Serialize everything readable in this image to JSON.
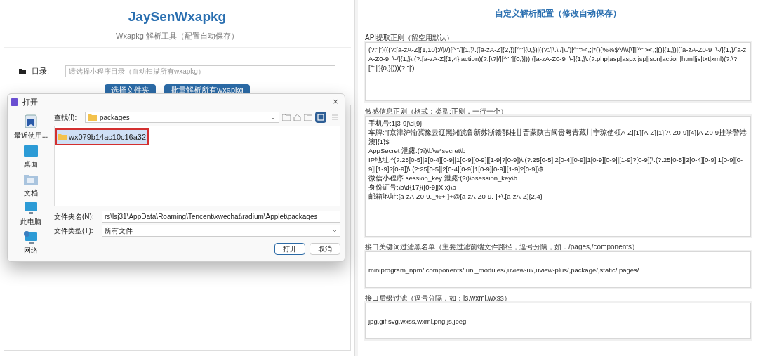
{
  "app": {
    "title": "JaySenWxapkg",
    "subtitle": "Wxapkg 解析工具（配置自动保存）"
  },
  "directory": {
    "label": "目录:",
    "placeholder": "请选择小程序目录（自动扫描所有wxapkg）"
  },
  "actions": [
    "选择文件夹",
    "批量解析所有wxapkg"
  ],
  "dialog": {
    "title": "打开",
    "close": "×",
    "places": [
      {
        "kind": "recent",
        "label": "最近使用..."
      },
      {
        "kind": "desktop",
        "label": "桌面"
      },
      {
        "kind": "documents",
        "label": "文档"
      },
      {
        "kind": "computer",
        "label": "此电脑"
      },
      {
        "kind": "network",
        "label": "网络"
      }
    ],
    "look_in": {
      "label": "查找(I):",
      "value": "packages"
    },
    "view_buttons": [
      {
        "kind": "detail",
        "selected": true
      },
      {
        "kind": "list",
        "selected": false
      }
    ],
    "files": [
      {
        "name": "wx079b14ac10c16a32",
        "selected": true
      }
    ],
    "filename": {
      "label": "文件夹名(N):",
      "value": "rs\\lsj31\\AppData\\Roaming\\Tencent\\xwechat\\radium\\Applet\\packages"
    },
    "filetype": {
      "label": "文件类型(T):",
      "value": "所有文件"
    },
    "buttons": [
      "打开",
      "取消"
    ]
  },
  "config": {
    "title": "自定义解析配置（修改自动保存）",
    "groups": [
      {
        "label": "API提取正则（留空用默认）",
        "lines": [
          "(?:\"|')(((?:[a-zA-Z]{1,10}://|//)[^\"'/]{1,}\\.([a-zA-Z]{2,})[^\"']{0,})|((?:/|\\.\\./|\\./)[^\"'><,;|*()(%%$^/\\\\\\[\\]][^\"'><,;|()]{1,})|([a-zA-Z0-9_\\-/]{1,}/[a-zA-Z0-9_\\-/]{1,}\\.(?:[a-zA-Z]{1,4}|action)(?:[\\?|/][^\"|']{0,}|))|([a-zA-Z0-9_\\-]{1,}\\.(?:php|asp|aspx|jsp|json|action|html|js|txt|xml)(?:\\?[^\"|']{0,}|)))(?:\"|')"
        ]
      },
      {
        "label": "敏感信息正则（格式：类型:正则，一行一个）",
        "lines": [
          "手机号:1[3-9]\\d{9}",
          "车牌:^[京津沪渝冀豫云辽黑湘皖鲁新苏浙赣鄂桂甘晋蒙陕吉闽贵粤青藏川宁琼使领A-Z]{1}[A-Z]{1}[A-Z0-9]{4}[A-Z0-9挂学警港澳]{1}$",
          "AppSecret 泄露:(?i)\\b\\w*secret\\b",
          "IP地址:^(?:25[0-5]|2[0-4][0-9]|1[0-9][0-9]|[1-9]?[0-9])\\.(?:25[0-5]|2[0-4][0-9]|1[0-9][0-9]|[1-9]?[0-9])\\.(?:25[0-5]|2[0-4][0-9]|1[0-9][0-9]|[1-9]?[0-9])\\.(?:25[0-5]|2[0-4][0-9]|1[0-9][0-9]|[1-9]?[0-9])$",
          "微信小程序 session_key 泄露:(?i)\\bsession_key\\b",
          "身份证号:\\b\\d{17}([0-9]|X|x)\\b",
          "邮箱地址:[a-zA-Z0-9._%+-]+@[a-zA-Z0-9.-]+\\.[a-zA-Z]{2,4}"
        ]
      },
      {
        "label": "接口关键词过滤黑名单（主要过滤前端文件路径，逗号分隔，如：/pages,/components）",
        "lines": [
          "miniprogram_npm/,components/,uni_modules/,uview-ui/,uview-plus/,package/,static/,pages/"
        ]
      },
      {
        "label": "接口后缀过滤（逗号分隔，如：js,wxml,wxss）",
        "lines": [
          "jpg,gif,svg,wxss,wxml,png,js,jpeg"
        ]
      }
    ]
  }
}
